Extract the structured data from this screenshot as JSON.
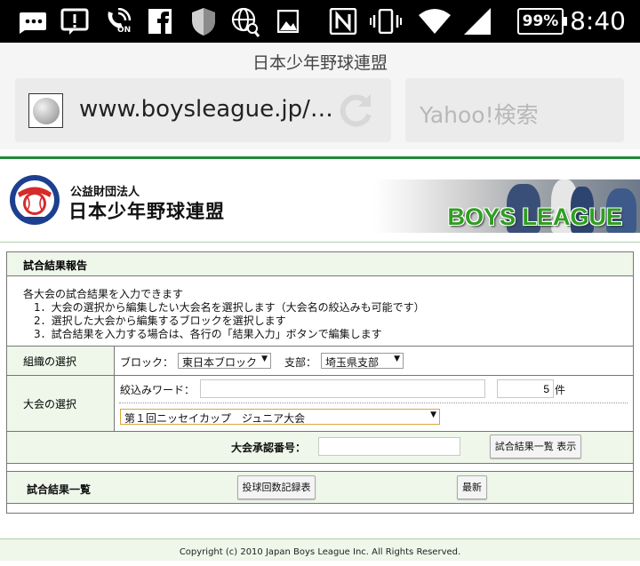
{
  "status_bar": {
    "time": "8:40",
    "battery": "99%",
    "icons": [
      "chat-bubble-icon",
      "alert-icon",
      "wifi-calling-on-icon",
      "facebook-icon",
      "shield-icon",
      "globe-search-icon",
      "image-icon",
      "nfc-icon",
      "vibrate-icon",
      "wifi-icon",
      "signal-icon"
    ],
    "wifi_call_label": "ON"
  },
  "browser": {
    "page_title": "日本少年野球連盟",
    "url": "www.boysleague.jp/…",
    "search_placeholder": "Yahoo!検索"
  },
  "site": {
    "org_kind": "公益財団法人",
    "org_name": "日本少年野球連盟",
    "banner_text": "BOYS LEAGUE",
    "accent_color": "#1f8a3a"
  },
  "form": {
    "title": "試合結果報告",
    "description": "各大会の試合結果を入力できます\n　1．大会の選択から編集したい大会名を選択します（大会名の絞込みも可能です）\n　2．選択した大会から編集するブロックを選択します\n　3．試合結果を入力する場合は、各行の「結果入力」ボタンで編集します",
    "org_select": {
      "label": "組織の選択",
      "block_label": "ブロック：",
      "block_value": "東日本ブロック",
      "branch_label": "支部：",
      "branch_value": "埼玉県支部"
    },
    "tournament_select": {
      "label": "大会の選択",
      "filter_label": "絞込みワード：",
      "filter_value": "",
      "count_value": "5",
      "count_unit": "件",
      "tournament_value": "第１回ニッセイカップ　ジュニア大会"
    },
    "approval": {
      "label": "大会承認番号：",
      "value": "",
      "show_button": "試合結果一覧 表示"
    },
    "results": {
      "label": "試合結果一覧",
      "pitch_record_button": "投球回数記録表",
      "latest_button": "最新"
    }
  },
  "footer": {
    "copyright": "Copyright (c) 2010 Japan Boys League Inc. All Rights Reserved."
  }
}
